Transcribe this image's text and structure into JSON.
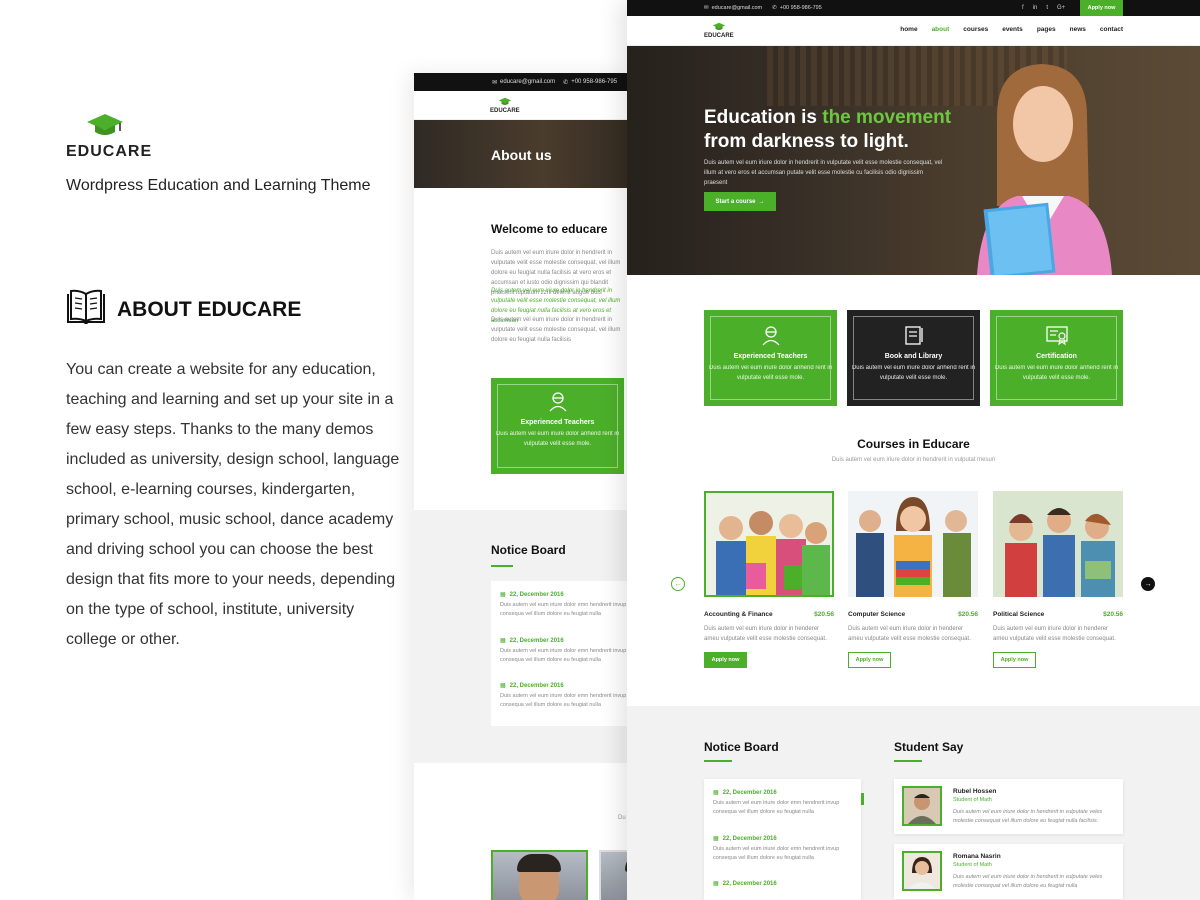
{
  "colors": {
    "accent": "#4caf2a",
    "dark": "#111111",
    "text": "#333333",
    "muted": "#888888"
  },
  "intro": {
    "brand": "EDUCARE",
    "tagline": "Wordpress Education and Learning Theme",
    "about_heading": "ABOUT EDUCARE",
    "about_text": "You can create a website for any education, teaching and learning and set up your site in a few easy steps. Thanks to the many demos included as university, design school, language school, e-learning courses, kindergarten, primary school, music school, dance academy and driving school you can choose the best design that fits more to your needs, depending on the type of school, institute, university college or other."
  },
  "about_page": {
    "email": "educare@gmail.com",
    "phone": "+00 958-986-795",
    "logo": "EDUCARE",
    "hero_title": "About us",
    "welcome_title": "Welcome to educare",
    "para1": "Duis autem vel eum iriure dolor in hendrerit in vulputate velit esse molestie consequat, vel illum dolore eu feugiat nulla facilisis at vero eros et accumsan et iusto odio dignissim qui blandit praesent luptatum zzril delenit augue duis",
    "para2": "Duis autem vel eum iriure dolor in hendrerit in vulputate velit esse molestie consequat, vel illum dolore eu feugiat nulla facilisis at vero eros et accumsan",
    "para3": "Duis autem vel eum iriure dolor in hendrerit in vulputate velit esse molestie consequat, vel illum dolore eu feugiat nulla facilisis",
    "feature_title": "Experienced Teachers",
    "feature_text": "Duis autem vel eum iriure dolor anhend rerit in vulputate velit esse mole.",
    "notice_title": "Notice Board",
    "notices": [
      {
        "date": "22, December 2016",
        "text": "Duis autem vel eum iriure dolor emn hendrerit invup consequa vel illum dolore eu feugiat nulla"
      },
      {
        "date": "22, December 2016",
        "text": "Duis autem vel eum iriure dolor emn hendrerit invup consequa vel illum dolore eu feugiat nulla"
      },
      {
        "date": "22, December 2016",
        "text": "Duis autem vel eum iriure dolor emn hendrerit invup consequa vel illum dolore eu feugiat nulla"
      }
    ],
    "bottom_text": "Du"
  },
  "home": {
    "email": "educare@gmail.com",
    "phone": "+00 958-986-795",
    "social": [
      "f",
      "in",
      "t",
      "G+"
    ],
    "apply_now": "Apply now",
    "logo": "EDUCARE",
    "nav": [
      "home",
      "about",
      "courses",
      "events",
      "pages",
      "news",
      "contact"
    ],
    "hero": {
      "title_part1": "Education is ",
      "title_highlight": "the movement",
      "title_part2": "from darkness to light.",
      "text": "Duis autem vel eum iriure dolor in hendrerit in vulputate velit esse molestie consequat, vel illum at vero eros et accumsan putate velit esse molestie cu facilisis odio dignissim praesent",
      "button": "Start a course"
    },
    "features": [
      {
        "title": "Experienced Teachers",
        "text": "Duis autem vel eum iriure dolor anhend rerit in vulputate velit esse mole."
      },
      {
        "title": "Book and Library",
        "text": "Duis autem vel eum iriure dolor anhend rerit in vulputate velit esse mole."
      },
      {
        "title": "Certification",
        "text": "Duis autem vel eum iriure dolor anhend rerit in vulputate velit esse mole."
      }
    ],
    "courses_title": "Courses in Educare",
    "courses_sub": "Duis autem vel eum iriure dolor in hendrerit in vulputat mesun",
    "courses": [
      {
        "name": "Accounting & Finance",
        "price": "$20.56",
        "text": "Duis autem vel eum iriure dolor in henderer ameu vulputate velit esse molestie consequat.",
        "button": "Apply now"
      },
      {
        "name": "Computer Science",
        "price": "$20.56",
        "text": "Duis autem vel eum iriure dolor in henderer ameu vulputate velit esse molestie consequat.",
        "button": "Apply now"
      },
      {
        "name": "Political Science",
        "price": "$20.56",
        "text": "Duis autem vel eum iriure dolor in henderer ameu vulputate velit esse molestie consequat.",
        "button": "Apply now"
      }
    ],
    "notice_title": "Notice Board",
    "notices": [
      {
        "date": "22, December 2016",
        "text": "Duis autem vel eum iriure dolor emn hendrerit invup consequa vel illum dolore eu feugiat nulla"
      },
      {
        "date": "22, December 2016",
        "text": "Duis autem vel eum iriure dolor emn hendrerit invup consequa vel illum dolore eu feugiat nulla"
      },
      {
        "date": "22, December 2016",
        "text": ""
      }
    ],
    "student_title": "Student Say",
    "students": [
      {
        "name": "Rubel Hossen",
        "role": "Student of Math",
        "quote": "Duis autem vel eum iriure dolor in hendrerit in vulputate veles molestie consequat vel illum dolore eu feugiat nulla facilisis."
      },
      {
        "name": "Romana Nasrin",
        "role": "Student of Math",
        "quote": "Duis autem vel eum iriure dolor in hendrerit in vulputate veles molestie consequat vel illum dolore eu feugiat nulla"
      }
    ]
  }
}
